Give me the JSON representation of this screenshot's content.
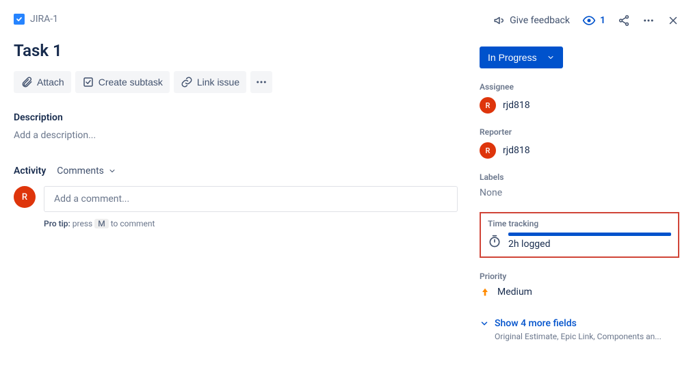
{
  "breadcrumb": {
    "issue_key": "JIRA-1"
  },
  "top_actions": {
    "feedback": "Give feedback",
    "watch_count": "1"
  },
  "title": "Task 1",
  "toolbar": {
    "attach": "Attach",
    "subtask": "Create subtask",
    "link": "Link issue"
  },
  "description": {
    "heading": "Description",
    "placeholder": "Add a description..."
  },
  "activity": {
    "heading": "Activity",
    "dropdown": "Comments",
    "comment_placeholder": "Add a comment...",
    "pro_tip_strong": "Pro tip:",
    "pro_tip_pre": "press",
    "pro_tip_key": "M",
    "pro_tip_post": "to comment",
    "avatar_initial": "R"
  },
  "status": {
    "label": "In Progress"
  },
  "fields": {
    "assignee": {
      "label": "Assignee",
      "value": "rjd818",
      "initial": "R"
    },
    "reporter": {
      "label": "Reporter",
      "value": "rjd818",
      "initial": "R"
    },
    "labels": {
      "label": "Labels",
      "value": "None"
    },
    "time_tracking": {
      "label": "Time tracking",
      "logged": "2h logged"
    },
    "priority": {
      "label": "Priority",
      "value": "Medium"
    }
  },
  "show_more": {
    "label": "Show 4 more fields",
    "sub": "Original Estimate, Epic Link, Components an..."
  }
}
